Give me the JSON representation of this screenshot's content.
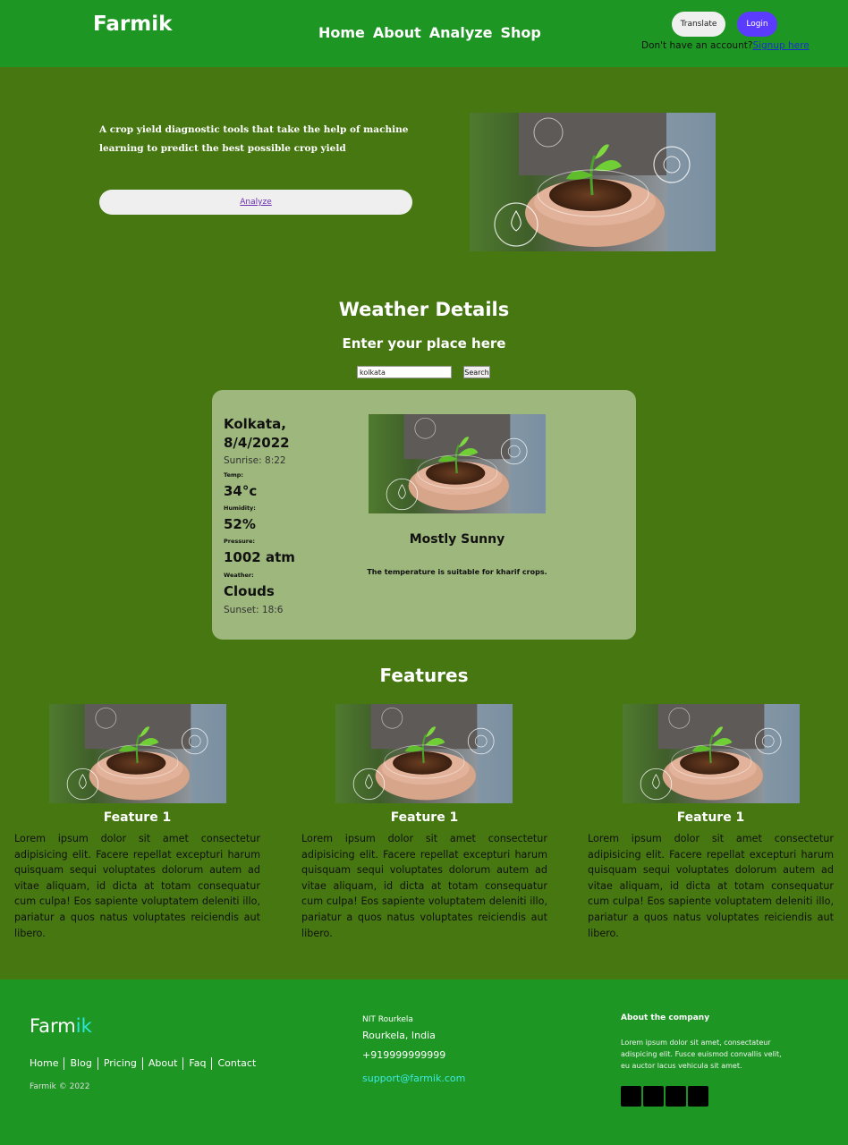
{
  "header": {
    "brand": "Farmik",
    "nav": [
      "Home",
      "About",
      "Analyze",
      "Shop"
    ],
    "translate_label": "Translate",
    "login_label": "Login",
    "signup_prompt": "Don't have an account?",
    "signup_link": "Signup here"
  },
  "hero": {
    "tagline": "A crop yield diagnostic tools that take the help of machine learning to predict the best possible crop yield",
    "analyze_label": "Analyze"
  },
  "weather": {
    "title": "Weather Details",
    "subtitle": "Enter your place here",
    "input_value": "kolkata",
    "search_label": "Search",
    "city": "Kolkata,",
    "date": "8/4/2022",
    "sunrise": "Sunrise: 8:22",
    "temp_label": "Temp:",
    "temp_value": "34°c",
    "humidity_label": "Humidity:",
    "humidity_value": "52%",
    "pressure_label": "Pressure:",
    "pressure_value": "1002 atm",
    "weather_label": "Weather:",
    "weather_value": "Clouds",
    "sunset": "Sunset: 18:6",
    "condition": "Mostly Sunny",
    "note": "The temperature is suitable for kharif crops."
  },
  "features": {
    "title": "Features",
    "items": [
      {
        "name": "Feature 1",
        "text": "Lorem ipsum dolor sit amet consectetur adipisicing elit. Facere repellat excepturi harum quisquam sequi voluptates dolorum autem ad vitae aliquam, id dicta at totam consequatur cum culpa! Eos sapiente voluptatem deleniti illo, pariatur a quos natus voluptates reiciendis aut libero."
      },
      {
        "name": "Feature 1",
        "text": "Lorem ipsum dolor sit amet consectetur adipisicing elit. Facere repellat excepturi harum quisquam sequi voluptates dolorum autem ad vitae aliquam, id dicta at totam consequatur cum culpa! Eos sapiente voluptatem deleniti illo, pariatur a quos natus voluptates reiciendis aut libero."
      },
      {
        "name": "Feature 1",
        "text": "Lorem ipsum dolor sit amet consectetur adipisicing elit. Facere repellat excepturi harum quisquam sequi voluptates dolorum autem ad vitae aliquam, id dicta at totam consequatur cum culpa! Eos sapiente voluptatem deleniti illo, pariatur a quos natus voluptates reiciendis aut libero."
      }
    ]
  },
  "footer": {
    "logo_main": "Farm",
    "logo_accent": "ik",
    "links": [
      "Home",
      "Blog",
      "Pricing",
      "About",
      "Faq",
      "Contact"
    ],
    "copyright": "Farmik © 2022",
    "address_line1": "NIT Rourkela",
    "address_line2": "Rourkela, India",
    "phone": "+919999999999",
    "email": "support@farmik.com",
    "about_heading": "About the company",
    "about_text": "Lorem ipsum dolor sit amet, consectateur adispicing elit. Fusce euismod convallis velit, eu auctor lacus vehicula sit amet."
  },
  "colors": {
    "header_bg": "#1e9624",
    "page_bg": "#467711",
    "card_bg": "#9db77c",
    "login_btn": "#5b3cff",
    "accent_cyan": "#2ee6dc"
  }
}
